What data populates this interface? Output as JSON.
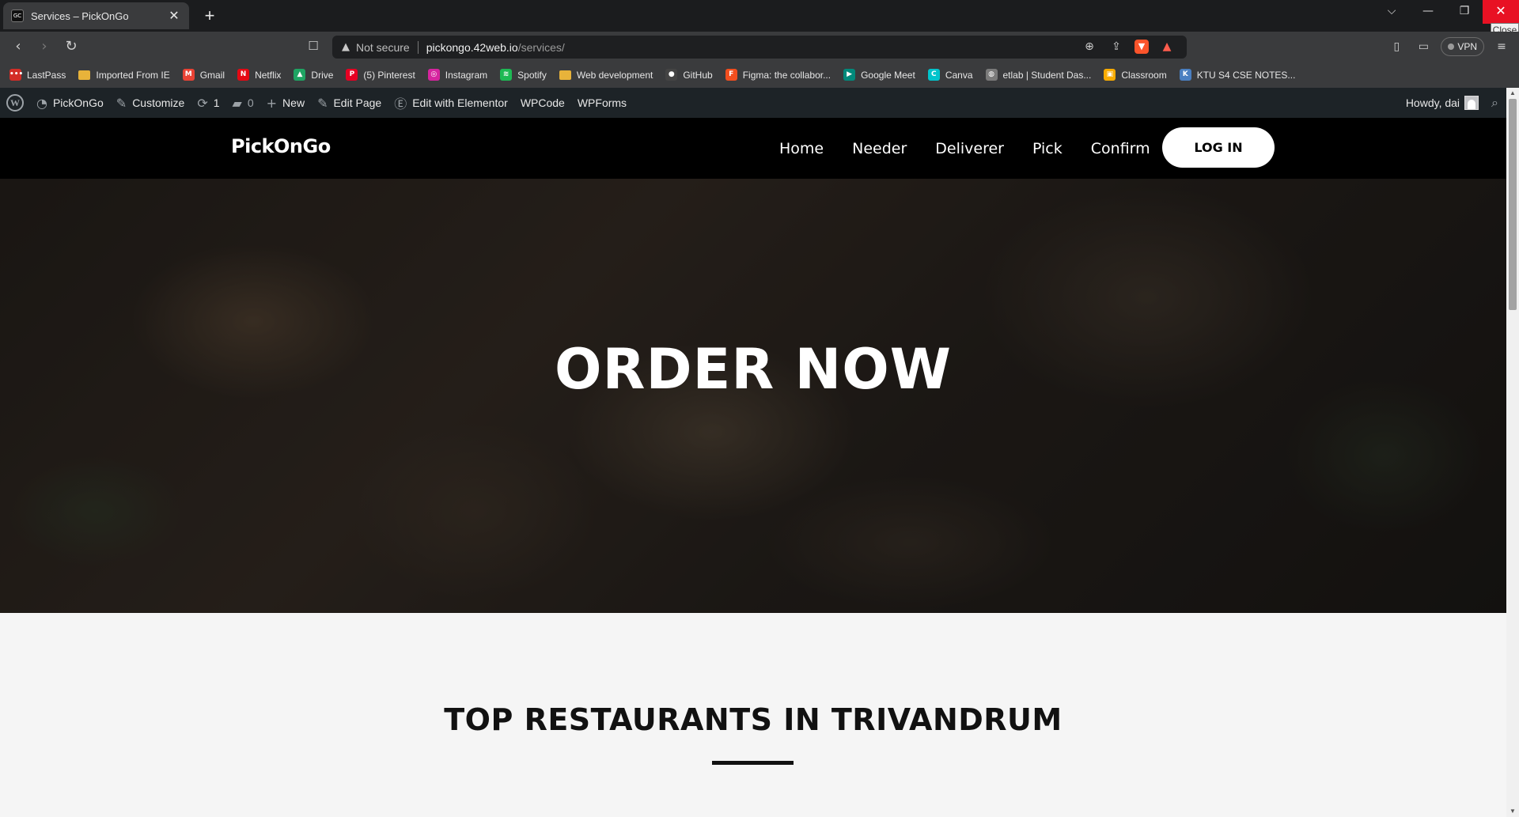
{
  "browser": {
    "tab_title": "Services – PickOnGo",
    "tab_favicon": "GC",
    "close_tooltip": "Close",
    "address": {
      "security": "Not secure",
      "host": "pickongo.42web.io",
      "path": "/services/"
    },
    "vpn_label": "VPN"
  },
  "bookmarks": [
    {
      "label": "LastPass",
      "icon": "lastpass-icon",
      "color": "#d32d27",
      "glyph": "•••"
    },
    {
      "label": "Imported From IE",
      "icon": "folder-icon",
      "color": "#e8b33a",
      "glyph": ""
    },
    {
      "label": "Gmail",
      "icon": "gmail-icon",
      "color": "#ea4335",
      "glyph": "M"
    },
    {
      "label": "Netflix",
      "icon": "netflix-icon",
      "color": "#e50914",
      "glyph": "N"
    },
    {
      "label": "Drive",
      "icon": "drive-icon",
      "color": "#1fa463",
      "glyph": "▲"
    },
    {
      "label": "(5) Pinterest",
      "icon": "pinterest-icon",
      "color": "#e60023",
      "glyph": "P"
    },
    {
      "label": "Instagram",
      "icon": "instagram-icon",
      "color": "#d6249f",
      "glyph": "◎"
    },
    {
      "label": "Spotify",
      "icon": "spotify-icon",
      "color": "#1db954",
      "glyph": "≋"
    },
    {
      "label": "Web development",
      "icon": "folder-icon",
      "color": "#e8b33a",
      "glyph": ""
    },
    {
      "label": "GitHub",
      "icon": "github-icon",
      "color": "#444444",
      "glyph": "●"
    },
    {
      "label": "Figma: the collabor...",
      "icon": "figma-icon",
      "color": "#f24e1e",
      "glyph": "F"
    },
    {
      "label": "Google Meet",
      "icon": "google-meet-icon",
      "color": "#00897b",
      "glyph": "▶"
    },
    {
      "label": "Canva",
      "icon": "canva-icon",
      "color": "#00c4cc",
      "glyph": "C"
    },
    {
      "label": "etlab | Student Das...",
      "icon": "globe-icon",
      "color": "#7a7a7a",
      "glyph": "◍"
    },
    {
      "label": "Classroom",
      "icon": "classroom-icon",
      "color": "#f9ab00",
      "glyph": "▣"
    },
    {
      "label": "KTU S4 CSE NOTES...",
      "icon": "ktu-icon",
      "color": "#4a7fc1",
      "glyph": "K"
    }
  ],
  "adminbar": {
    "site_name": "PickOnGo",
    "customize": "Customize",
    "updates_count": "1",
    "comments_count": "0",
    "new_label": "New",
    "edit_page": "Edit Page",
    "edit_elementor": "Edit with Elementor",
    "wpcode": "WPCode",
    "wpforms": "WPForms",
    "howdy": "Howdy, dai"
  },
  "site": {
    "logo": "PickOnGo",
    "nav": [
      "Home",
      "Needer",
      "Deliverer",
      "Pick",
      "Confirm"
    ],
    "login": "LOG IN"
  },
  "hero": {
    "title": "ORDER NOW"
  },
  "section": {
    "title": "TOP RESTAURANTS IN TRIVANDRUM"
  }
}
